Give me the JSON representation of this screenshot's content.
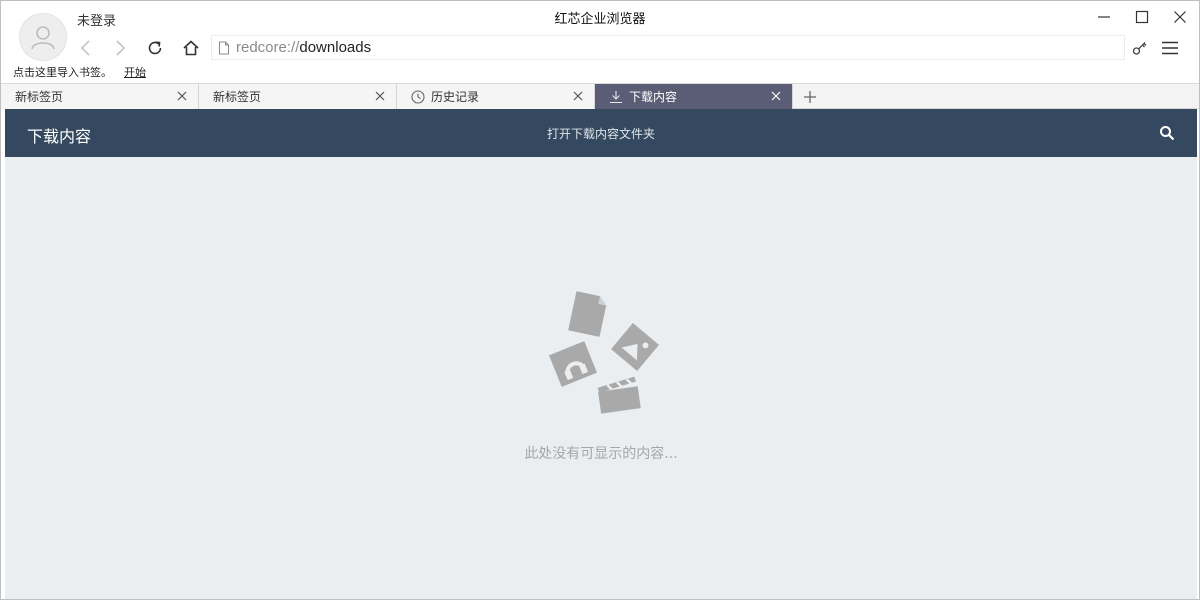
{
  "window": {
    "title": "红芯企业浏览器",
    "user_label": "未登录",
    "controls": [
      "minimize-icon",
      "maximize-icon",
      "close-icon"
    ]
  },
  "navbar": {
    "address_scheme": "redcore://",
    "address_path": "downloads",
    "icons": [
      "back-icon",
      "forward-icon",
      "reload-icon",
      "home-icon",
      "page-icon",
      "key-icon",
      "menu-icon"
    ]
  },
  "bookmarks": {
    "prompt": "点击这里导入书签。",
    "start_link": "开始"
  },
  "tabs": [
    {
      "label": "新标签页",
      "icon": "",
      "active": false
    },
    {
      "label": "新标签页",
      "icon": "",
      "active": false
    },
    {
      "label": "历史记录",
      "icon": "clock-icon",
      "active": false
    },
    {
      "label": "下载内容",
      "icon": "download-icon",
      "active": true
    }
  ],
  "page": {
    "title": "下载内容",
    "open_folder": "打开下载内容文件夹",
    "empty_message": "此处没有可显示的内容..."
  },
  "colors": {
    "header_bg": "#34495f",
    "active_tab_bg": "#5b5c75",
    "page_bg": "#eaeef1",
    "art_gray": "#a9a9a9"
  }
}
